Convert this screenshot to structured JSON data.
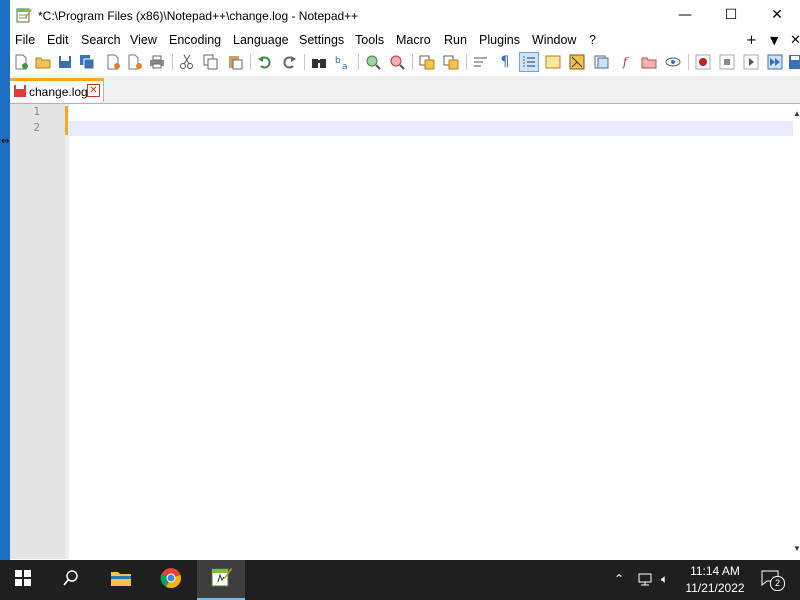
{
  "window": {
    "title": "*C:\\Program Files (x86)\\Notepad++\\change.log - Notepad++",
    "icon": "notepad-plus-plus-icon",
    "controls": {
      "minimize": "—",
      "maximize": "☐",
      "close": "✕"
    }
  },
  "menu": {
    "items": [
      "File",
      "Edit",
      "Search",
      "View",
      "Encoding",
      "Language",
      "Settings",
      "Tools",
      "Macro",
      "Run",
      "Plugins",
      "Window",
      "?"
    ],
    "right": {
      "plus": "+",
      "dropdown": "▼",
      "close": "✕"
    }
  },
  "toolbar": {
    "buttons": [
      "new-file",
      "open-file",
      "save",
      "save-all",
      "close",
      "close-all",
      "print",
      "cut",
      "copy",
      "paste",
      "undo",
      "redo",
      "find",
      "replace",
      "zoom-in",
      "zoom-out",
      "sync-vertical",
      "sync-horizontal",
      "word-wrap",
      "show-all-characters",
      "indent-guide",
      "user-defined-language",
      "document-map",
      "function-list",
      "folder-as-workspace",
      "monitoring",
      "record-macro",
      "stop-recording",
      "playback-macro",
      "run-macro-multiple",
      "save-macro"
    ],
    "active_button": "indent-guide"
  },
  "tabs": [
    {
      "label": "change.log",
      "icon": "save-state-red-icon",
      "close": "✕",
      "modified": true
    }
  ],
  "editor": {
    "line_numbers": [
      "1",
      "2"
    ],
    "current_line": 2,
    "colors": {
      "caret_accent": "#f5a623",
      "current_line_bg": "#e8e8ff",
      "gutter_bg": "#e4e4e4"
    }
  },
  "taskbar": {
    "apps": [
      "start-icon",
      "search-icon",
      "file-explorer-icon",
      "chrome-icon",
      "notepad-plus-plus-icon"
    ],
    "active_app": "notepad-plus-plus-icon",
    "time": "11:14 AM",
    "date": "11/21/2022",
    "notifications_count": "2"
  }
}
